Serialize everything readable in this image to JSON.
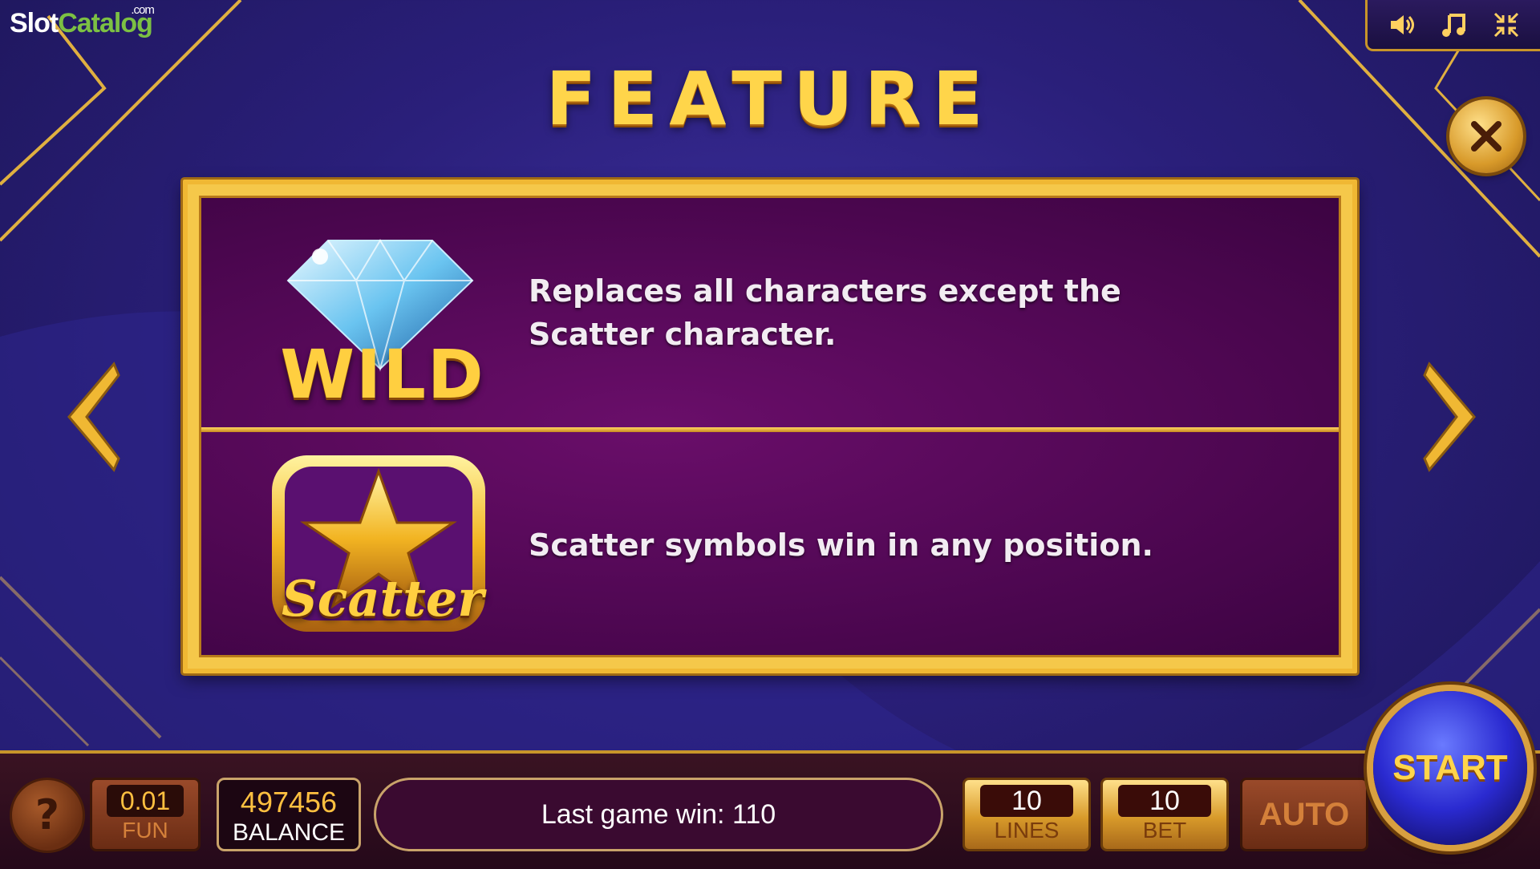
{
  "watermark": {
    "slot": "Slot",
    "catalog": "Catalog",
    "com": ".com"
  },
  "top_controls": {
    "icons": [
      "speaker-icon",
      "music-icon",
      "shrink-icon"
    ]
  },
  "title": "FEATURE",
  "features": [
    {
      "symbol_label": "WILD",
      "symbol_icon": "diamond-icon",
      "description": "Replaces all characters except the Scatter character."
    },
    {
      "symbol_label": "Scatter",
      "symbol_icon": "star-icon",
      "description": "Scatter symbols win in any position."
    }
  ],
  "bottom": {
    "help_label": "?",
    "coin": {
      "value": "0.01",
      "label": "FUN"
    },
    "balance": {
      "value": "497456",
      "label": "BALANCE"
    },
    "last_win": "Last game win: 110",
    "lines": {
      "value": "10",
      "label": "LINES"
    },
    "bet": {
      "value": "10",
      "label": "BET"
    },
    "auto_label": "AUTO",
    "start_label": "START"
  },
  "colors": {
    "gold": "#f0b833",
    "panel": "#5a0a5c",
    "background": "#2a1f7a",
    "start": "#2a2ad0"
  }
}
